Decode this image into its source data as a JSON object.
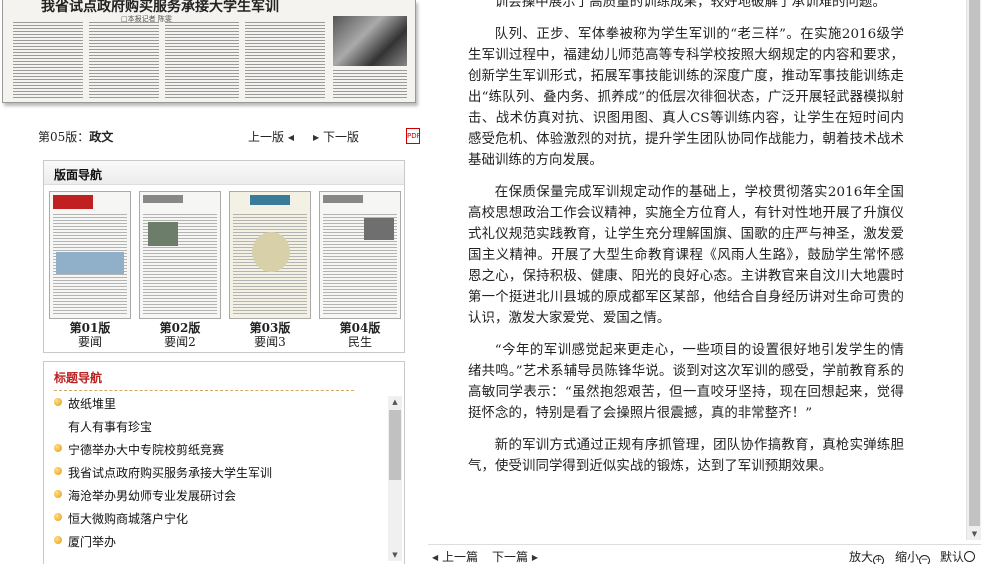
{
  "thumb_top": {
    "headline": "我省试点政府购买服务承接大学生军训",
    "byline": "□本报记者 陈雯"
  },
  "edition": {
    "label_prefix": "第05版：",
    "label_name": "政文",
    "prev": "上一版",
    "next": "下一版",
    "pdf_icon": "pdf-icon"
  },
  "page_nav": {
    "title": "版面导航",
    "pages": [
      {
        "num": "第01版",
        "section": "要闻"
      },
      {
        "num": "第02版",
        "section": "要闻2"
      },
      {
        "num": "第03版",
        "section": "要闻3"
      },
      {
        "num": "第04版",
        "section": "民生"
      }
    ]
  },
  "title_nav": {
    "title": "标题导航",
    "items": [
      {
        "text": "故纸堆里",
        "bullet": true
      },
      {
        "text": "有人有事有珍宝",
        "bullet": false
      },
      {
        "text": "宁德举办大中专院校剪纸竞赛",
        "bullet": true
      },
      {
        "text": "我省试点政府购买服务承接大学生军训",
        "bullet": true
      },
      {
        "text": "海沧举办男幼师专业发展研讨会",
        "bullet": true
      },
      {
        "text": "恒大微购商城落户宁化",
        "bullet": true
      },
      {
        "text": "厦门举办",
        "bullet": true
      }
    ]
  },
  "article": {
    "paragraphs": [
      "训会操中展示了高质量的训练成果，较好地破解了承训难的问题。",
      "队列、正步、军体拳被称为学生军训的“老三样”。在实施2016级学生军训过程中，福建幼儿师范高等专科学校按照大纲规定的内容和要求，创新学生军训形式，拓展军事技能训练的深度广度，推动军事技能训练走出“练队列、叠内务、抓养成”的低层次徘徊状态，广泛开展轻武器模拟射击、战术仿真对抗、识图用图、真人CS等训练内容，让学生在短时间内感受危机、体验激烈的对抗，提升学生团队协同作战能力，朝着技术战术基础训练的方向发展。",
      "在保质保量完成军训规定动作的基础上，学校贯彻落实2016年全国高校思想政治工作会议精神，实施全方位育人，有针对性地开展了升旗仪式礼仪规范实践教育，让学生充分理解国旗、国歌的庄严与神圣，激发爱国主义精神。开展了大型生命教育课程《风雨人生路》，鼓励学生常怀感恩之心，保持积极、健康、阳光的良好心态。主讲教官来自汶川大地震时第一个挺进北川县城的原成都军区某部，他结合自身经历讲对生命可贵的认识，激发大家爱党、爱国之情。",
      "“今年的军训感觉起来更走心，一些项目的设置很好地引发学生的情绪共鸣。”艺术系辅导员陈锋华说。谈到对这次军训的感受，学前教育系的高敏同学表示：“虽然抱怨艰苦，但一直咬牙坚持，现在回想起来，觉得挺怀念的，特别是看了会操照片很震撼，真的非常整齐！”",
      "新的军训方式通过正规有序抓管理，团队协作搞教育，真枪实弹练胆气，使受训同学得到近似实战的锻炼，达到了军训预期效果。"
    ]
  },
  "bottom_bar": {
    "prev": "上一篇",
    "next": "下一篇",
    "zoom_in": "放大",
    "zoom_out": "缩小",
    "default": "默认"
  },
  "colors": {
    "title_nav_accent": "#b22222",
    "bullet": "#e79a0c"
  }
}
